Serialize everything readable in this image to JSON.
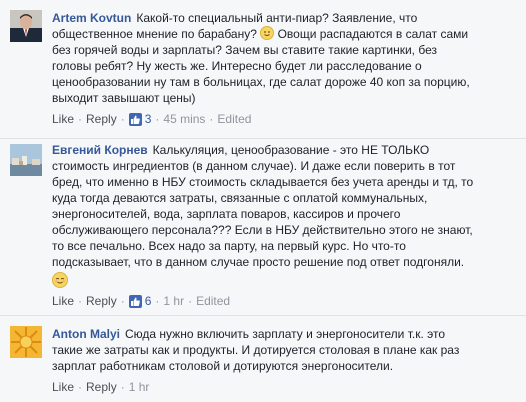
{
  "comments": [
    {
      "author": "Artem Kovtun",
      "line1": "Какой-то специальный анти-пиар? Заявление, что",
      "line2a": "общественное мнение по барабану?",
      "line2b": "Овощи распадаются в салат сами",
      "line3": "без горячей воды и зарплаты? Зачем вы ставите такие картинки, без",
      "line4": "головы ребят? Ну жесть же. Интересно будет ли расследование о",
      "line5": "ценообразовании ну там в больницах, где салат дороже 40 коп за порцию,",
      "line6": "выходит завышают цены)",
      "like_label": "Like",
      "reply_label": "Reply",
      "likes": "3",
      "time": "45 mins",
      "edited": "Edited",
      "emoji_icon": "slightly-smiling-emoji"
    },
    {
      "author": "Евгений Корнев",
      "line1": "Калькуляция, ценообразование - это НЕ ТОЛЬКО",
      "line2": "стоимость ингредиентов (в данном случае). И даже если поверить в тот",
      "line3": "бред, что именно в НБУ стоимость складывается без учета аренды и тд, то",
      "line4": "куда тогда деваются затраты, связанные с оплатой коммунальных,",
      "line5": "энергоносителей, вода, зарплата поваров, кассиров и прочего",
      "line6": "обслуживающего персонала??? Если в НБУ действительно этого не знают,",
      "line7": "то все печально. Всех надо за парту, на первый курс. Но что-то",
      "line8": "подсказывает, что в данном случае просто решение под ответ подгоняли.",
      "like_label": "Like",
      "reply_label": "Reply",
      "likes": "6",
      "time": "1 hr",
      "edited": "Edited",
      "emoji_icon": "relieved-emoji"
    },
    {
      "author": "Anton Malyi",
      "line1": "Сюда нужно включить зарплату и энергоносители т.к. это",
      "line2": "такие же затраты как и продукты. И дотируется столовая в плане как раз",
      "line3": "зарплат работникам столовой и дотируются энергоносители.",
      "like_label": "Like",
      "reply_label": "Reply",
      "time": "1 hr"
    }
  ],
  "icons": {
    "like": "thumbs-up-icon"
  },
  "colors": {
    "author": "#365899",
    "like_badge": "#4267b2",
    "background": "#f6f7f9"
  }
}
